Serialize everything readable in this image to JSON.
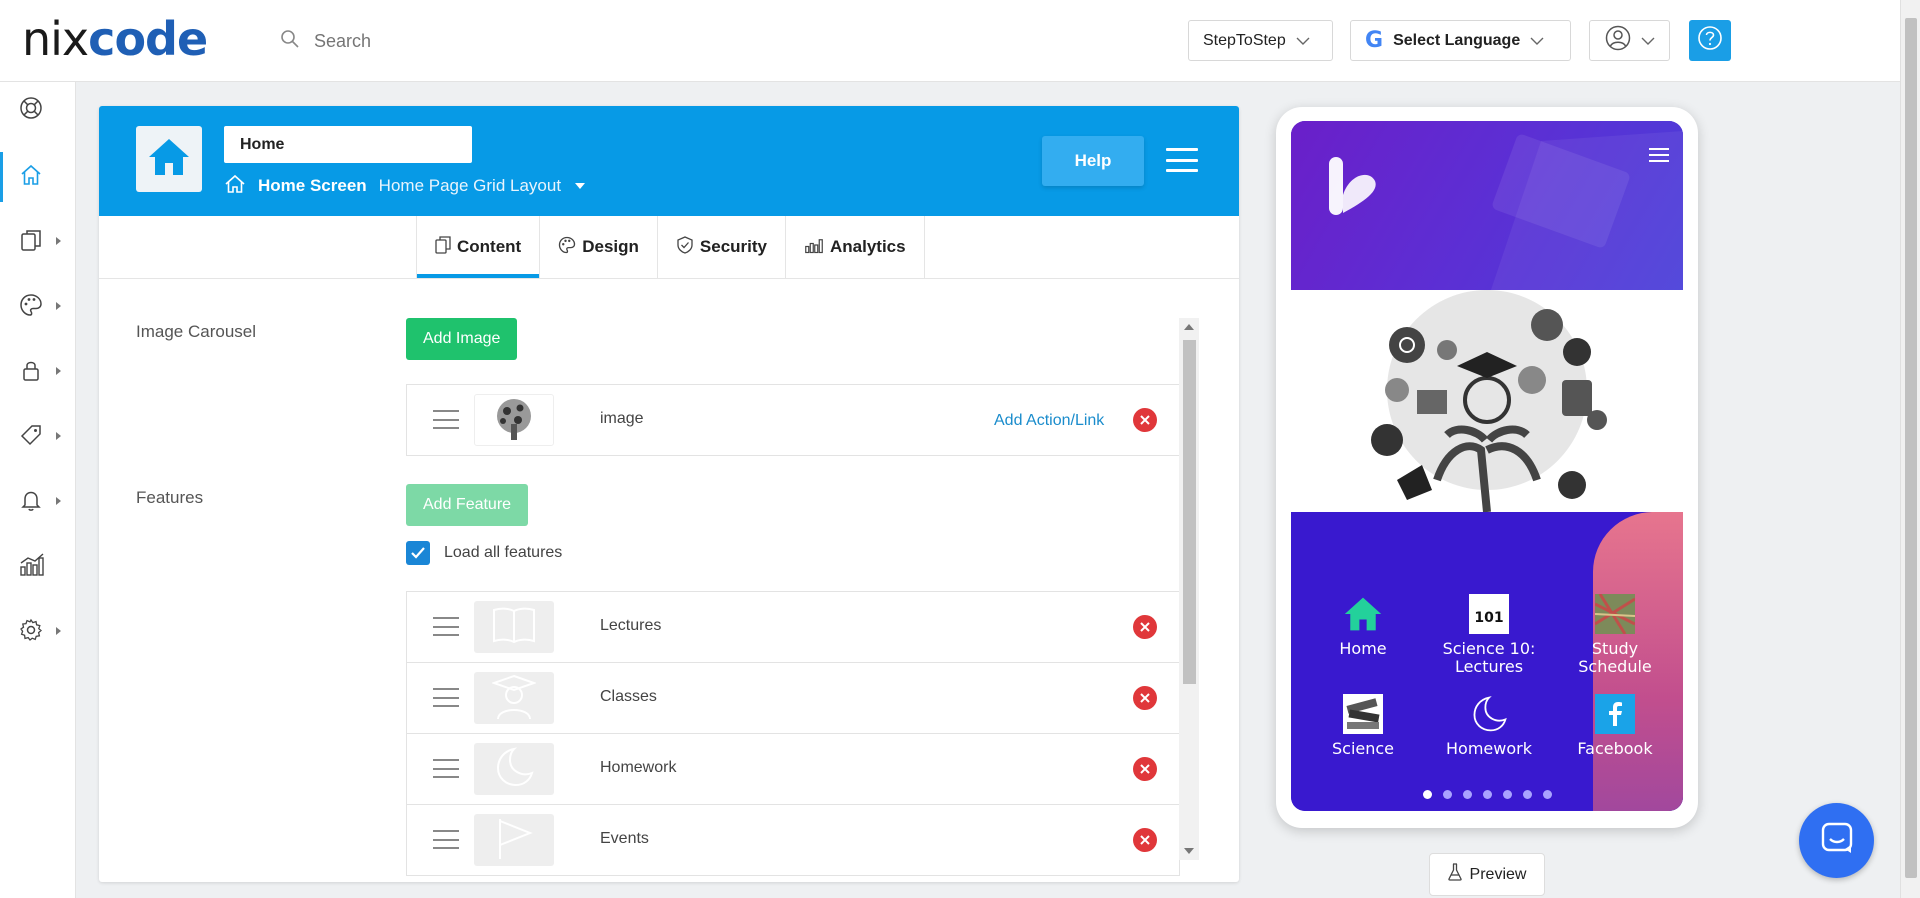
{
  "brand": {
    "logo_part1": "nix",
    "logo_part2": "code"
  },
  "header": {
    "search_placeholder": "Search",
    "project_dropdown": "StepToStep",
    "language_dropdown": "Select Language"
  },
  "sidebar": {
    "items": [
      {
        "icon": "lifebuoy-icon"
      },
      {
        "icon": "home-icon",
        "active": true
      },
      {
        "icon": "pages-icon"
      },
      {
        "icon": "palette-icon"
      },
      {
        "icon": "lock-icon"
      },
      {
        "icon": "tag-icon"
      },
      {
        "icon": "bell-icon"
      },
      {
        "icon": "chart-icon"
      },
      {
        "icon": "gear-icon"
      }
    ]
  },
  "editor": {
    "screen_name": "Home",
    "breadcrumb_screen": "Home Screen",
    "breadcrumb_layout": "Home Page Grid Layout",
    "help_label": "Help",
    "tabs": [
      {
        "label": "Content",
        "icon": "copy-icon",
        "active": true
      },
      {
        "label": "Design",
        "icon": "palette-icon"
      },
      {
        "label": "Security",
        "icon": "shield-icon"
      },
      {
        "label": "Analytics",
        "icon": "chart-icon"
      }
    ],
    "carousel": {
      "label": "Image Carousel",
      "add_button": "Add Image",
      "items": [
        {
          "label": "image",
          "action_link": "Add Action/Link"
        }
      ]
    },
    "features": {
      "label": "Features",
      "add_button": "Add Feature",
      "load_all_label": "Load all features",
      "load_all_checked": true,
      "items": [
        {
          "label": "Lectures",
          "icon": "book-icon"
        },
        {
          "label": "Classes",
          "icon": "graduate-icon"
        },
        {
          "label": "Homework",
          "icon": "moon-icon"
        },
        {
          "label": "Events",
          "icon": "flag-icon"
        }
      ]
    }
  },
  "phone_preview": {
    "grid": [
      {
        "label": "Home",
        "icon": "home-icon"
      },
      {
        "label": "Science 10: Lectures",
        "icon": "science-101-icon",
        "badge": "101"
      },
      {
        "label": "Study Schedule",
        "icon": "map-icon"
      },
      {
        "label": "Science",
        "icon": "books-icon"
      },
      {
        "label": "Homework",
        "icon": "moon-icon"
      },
      {
        "label": "Facebook",
        "icon": "facebook-icon"
      }
    ],
    "page_count": 7,
    "current_page": 1
  },
  "preview_button": "Preview",
  "colors": {
    "primary": "#079ae6",
    "green": "#1fc26d",
    "danger": "#e0373a",
    "phone_bg": "#3919cf"
  }
}
